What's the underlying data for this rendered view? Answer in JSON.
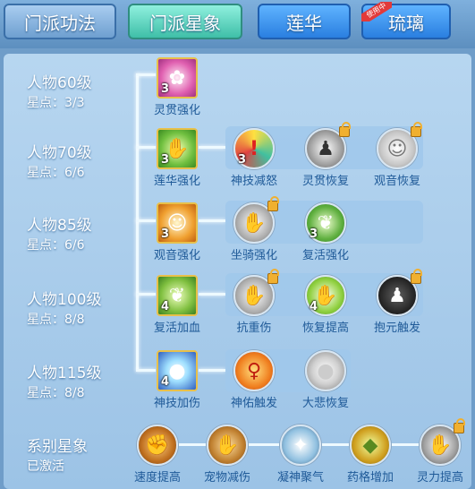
{
  "tabs": [
    {
      "label": "门派功法",
      "state": "inactive"
    },
    {
      "label": "门派星象",
      "state": "active"
    },
    {
      "label": "莲华",
      "state": "blue"
    },
    {
      "label": "琉璃",
      "state": "blue",
      "badge": "使用中"
    }
  ],
  "rows": [
    {
      "title": "人物60级",
      "stars": "星点：3/3"
    },
    {
      "title": "人物70级",
      "stars": "星点：6/6"
    },
    {
      "title": "人物85级",
      "stars": "星点：6/6"
    },
    {
      "title": "人物100级",
      "stars": "星点：8/8"
    },
    {
      "title": "人物115级",
      "stars": "星点：8/8"
    }
  ],
  "skills": {
    "r1": [
      {
        "name": "灵贯强化",
        "num": "3"
      }
    ],
    "r2": [
      {
        "name": "莲华强化",
        "num": "3"
      },
      {
        "name": "神技减怒",
        "num": "3"
      },
      {
        "name": "灵贯恢复",
        "num": ""
      },
      {
        "name": "观音恢复",
        "num": ""
      }
    ],
    "r3": [
      {
        "name": "观音强化",
        "num": "3"
      },
      {
        "name": "坐骑强化",
        "num": ""
      },
      {
        "name": "复活强化",
        "num": "3"
      }
    ],
    "r4": [
      {
        "name": "复活加血",
        "num": "4"
      },
      {
        "name": "抗重伤",
        "num": ""
      },
      {
        "name": "恢复提高",
        "num": "4"
      },
      {
        "name": "抱元触发",
        "num": ""
      }
    ],
    "r5": [
      {
        "name": "神技加伤",
        "num": "4"
      },
      {
        "name": "神佑触发",
        "num": ""
      },
      {
        "name": "大悲恢复",
        "num": ""
      }
    ]
  },
  "series": {
    "title": "系别星象",
    "status": "已激活",
    "skills": [
      {
        "name": "速度提高"
      },
      {
        "name": "宠物减伤"
      },
      {
        "name": "凝神聚气"
      },
      {
        "name": "药格增加"
      },
      {
        "name": "灵力提高"
      }
    ]
  }
}
